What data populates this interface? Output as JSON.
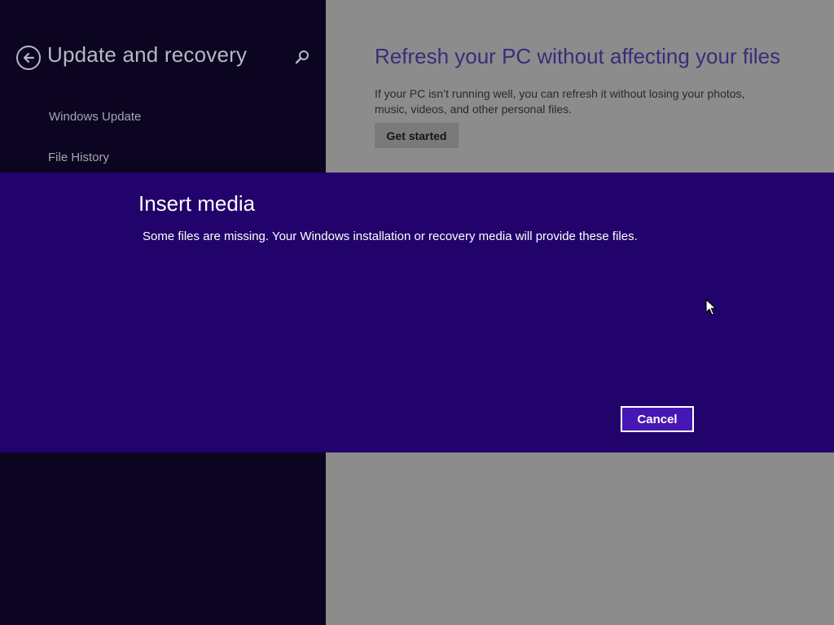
{
  "nav": {
    "title": "Update and recovery",
    "back_icon": "back-arrow-icon",
    "search_icon": "search-icon",
    "items": [
      {
        "label": "Windows Update"
      },
      {
        "label": "File History"
      }
    ]
  },
  "content": {
    "section_title": "Refresh your PC without affecting your files",
    "description": "If your PC isn’t running well, you can refresh it without losing your photos, music, videos, and other personal files.",
    "get_started_label": "Get started"
  },
  "dialog": {
    "title": "Insert media",
    "message": "Some files are missing. Your Windows installation or recovery media will provide these files.",
    "cancel_label": "Cancel"
  },
  "colors": {
    "nav_background": "#0c0522",
    "content_background_dimmed": "#8c8c8c",
    "dialog_background": "#22036b",
    "accent": "#4617b4",
    "section_title": "#3a2c7a"
  }
}
